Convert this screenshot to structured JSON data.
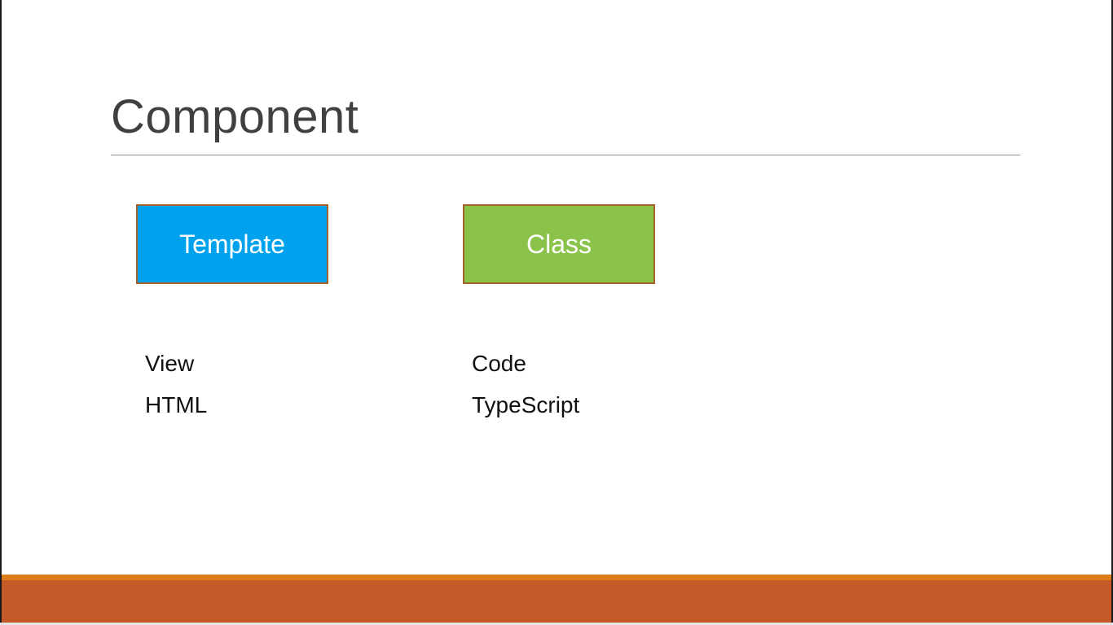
{
  "slide": {
    "title": "Component",
    "boxes": [
      {
        "label": "Template",
        "fill": "#00a2ed"
      },
      {
        "label": "Class",
        "fill": "#8bc34a"
      }
    ],
    "columns": [
      {
        "lines": [
          "View",
          "HTML"
        ]
      },
      {
        "lines": [
          "Code",
          "TypeScript"
        ]
      }
    ]
  },
  "theme": {
    "box_border": "#a0642a",
    "footer_accent": "#e07b1a",
    "footer_band": "#c55a28",
    "title_color": "#404040",
    "rule_color": "#8c8c8c"
  }
}
